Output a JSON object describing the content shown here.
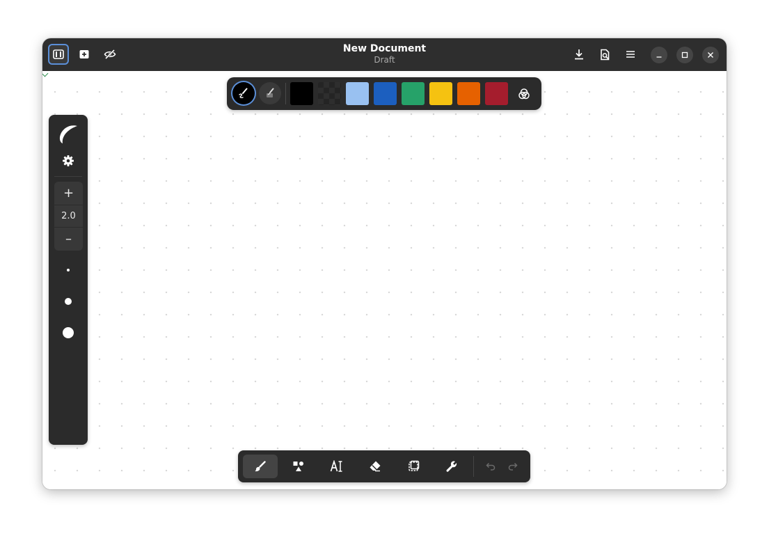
{
  "window": {
    "title": "New Document",
    "subtitle": "Draft"
  },
  "titlebar": {
    "left_buttons": [
      "sidebar-toggle-icon",
      "new-page-icon",
      "visibility-off-icon"
    ],
    "right_buttons": [
      "download-icon",
      "export-document-icon",
      "menu-icon"
    ],
    "window_controls": [
      "minimize-icon",
      "maximize-icon",
      "close-icon"
    ]
  },
  "palette": {
    "tools": [
      "pen-stroke-icon",
      "brush-fill-icon"
    ],
    "colors": [
      {
        "name": "black",
        "hex": "#000000"
      },
      {
        "name": "transparent",
        "hex": "transparent"
      },
      {
        "name": "light-blue",
        "hex": "#99c1f1"
      },
      {
        "name": "blue",
        "hex": "#1c5fbf"
      },
      {
        "name": "green",
        "hex": "#26a269"
      },
      {
        "name": "yellow",
        "hex": "#f5c211"
      },
      {
        "name": "orange",
        "hex": "#e66100"
      },
      {
        "name": "red",
        "hex": "#a51d2d"
      }
    ],
    "picker_icon": "color-mix-icon"
  },
  "sidebar": {
    "pen_style_icon": "pen-style-icon",
    "settings_icon": "gear-icon",
    "zoom": {
      "increase": "+",
      "value": "2.0",
      "decrease": "–"
    },
    "stroke_sizes": [
      "small",
      "medium",
      "large"
    ]
  },
  "toolbar": {
    "tools": [
      "brush-icon",
      "shapes-icon",
      "text-tool-icon",
      "eraser-icon",
      "selection-icon",
      "wrench-icon"
    ],
    "active_tool": "brush-icon",
    "history": [
      "undo-icon",
      "redo-icon"
    ]
  },
  "theme": {
    "chrome_dark": "#2e2e2e",
    "panel": "#2b2b2b",
    "accent": "#5b8fd8"
  }
}
